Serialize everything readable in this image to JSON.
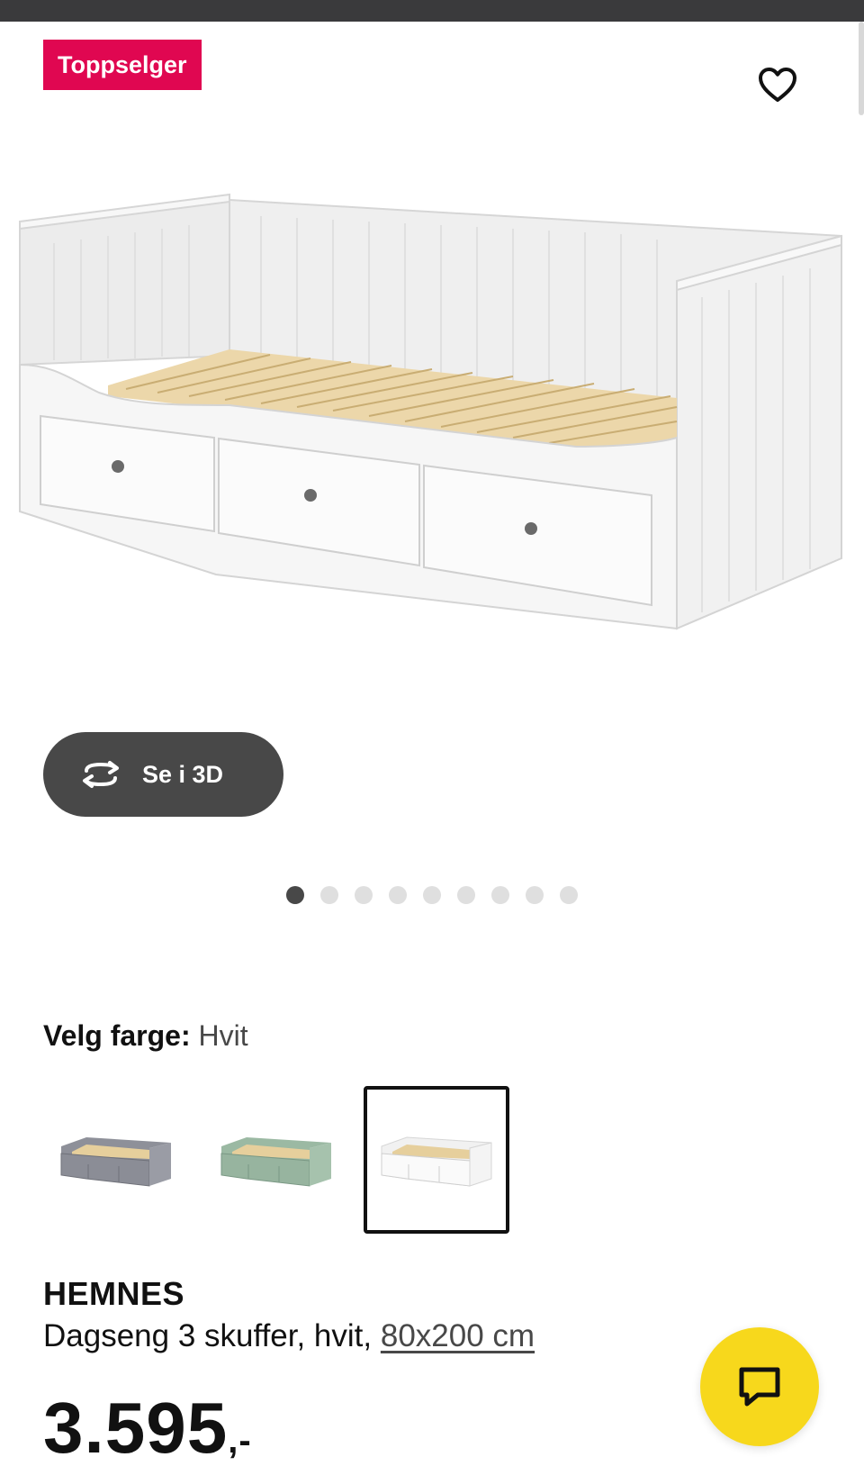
{
  "badge": {
    "label": "Toppselger",
    "color": "#e00751"
  },
  "favorite": {
    "icon": "heart-outline-icon"
  },
  "gallery": {
    "view_3d_label": "Se i 3D",
    "view_3d_icon": "rotate-3d-icon",
    "image_count": 9,
    "active_index": 0
  },
  "color_picker": {
    "label": "Velg farge:",
    "value": "Hvit",
    "options": [
      {
        "name": "grå",
        "selected": false
      },
      {
        "name": "grønn",
        "selected": false
      },
      {
        "name": "hvit",
        "selected": true
      }
    ]
  },
  "product": {
    "name": "HEMNES",
    "description": "Dagseng 3 skuffer, hvit,",
    "size_link": "80x200 cm",
    "price": "3.595",
    "price_suffix": ",-"
  },
  "chat": {
    "icon": "chat-bubble-icon",
    "color": "#f7d81c"
  }
}
